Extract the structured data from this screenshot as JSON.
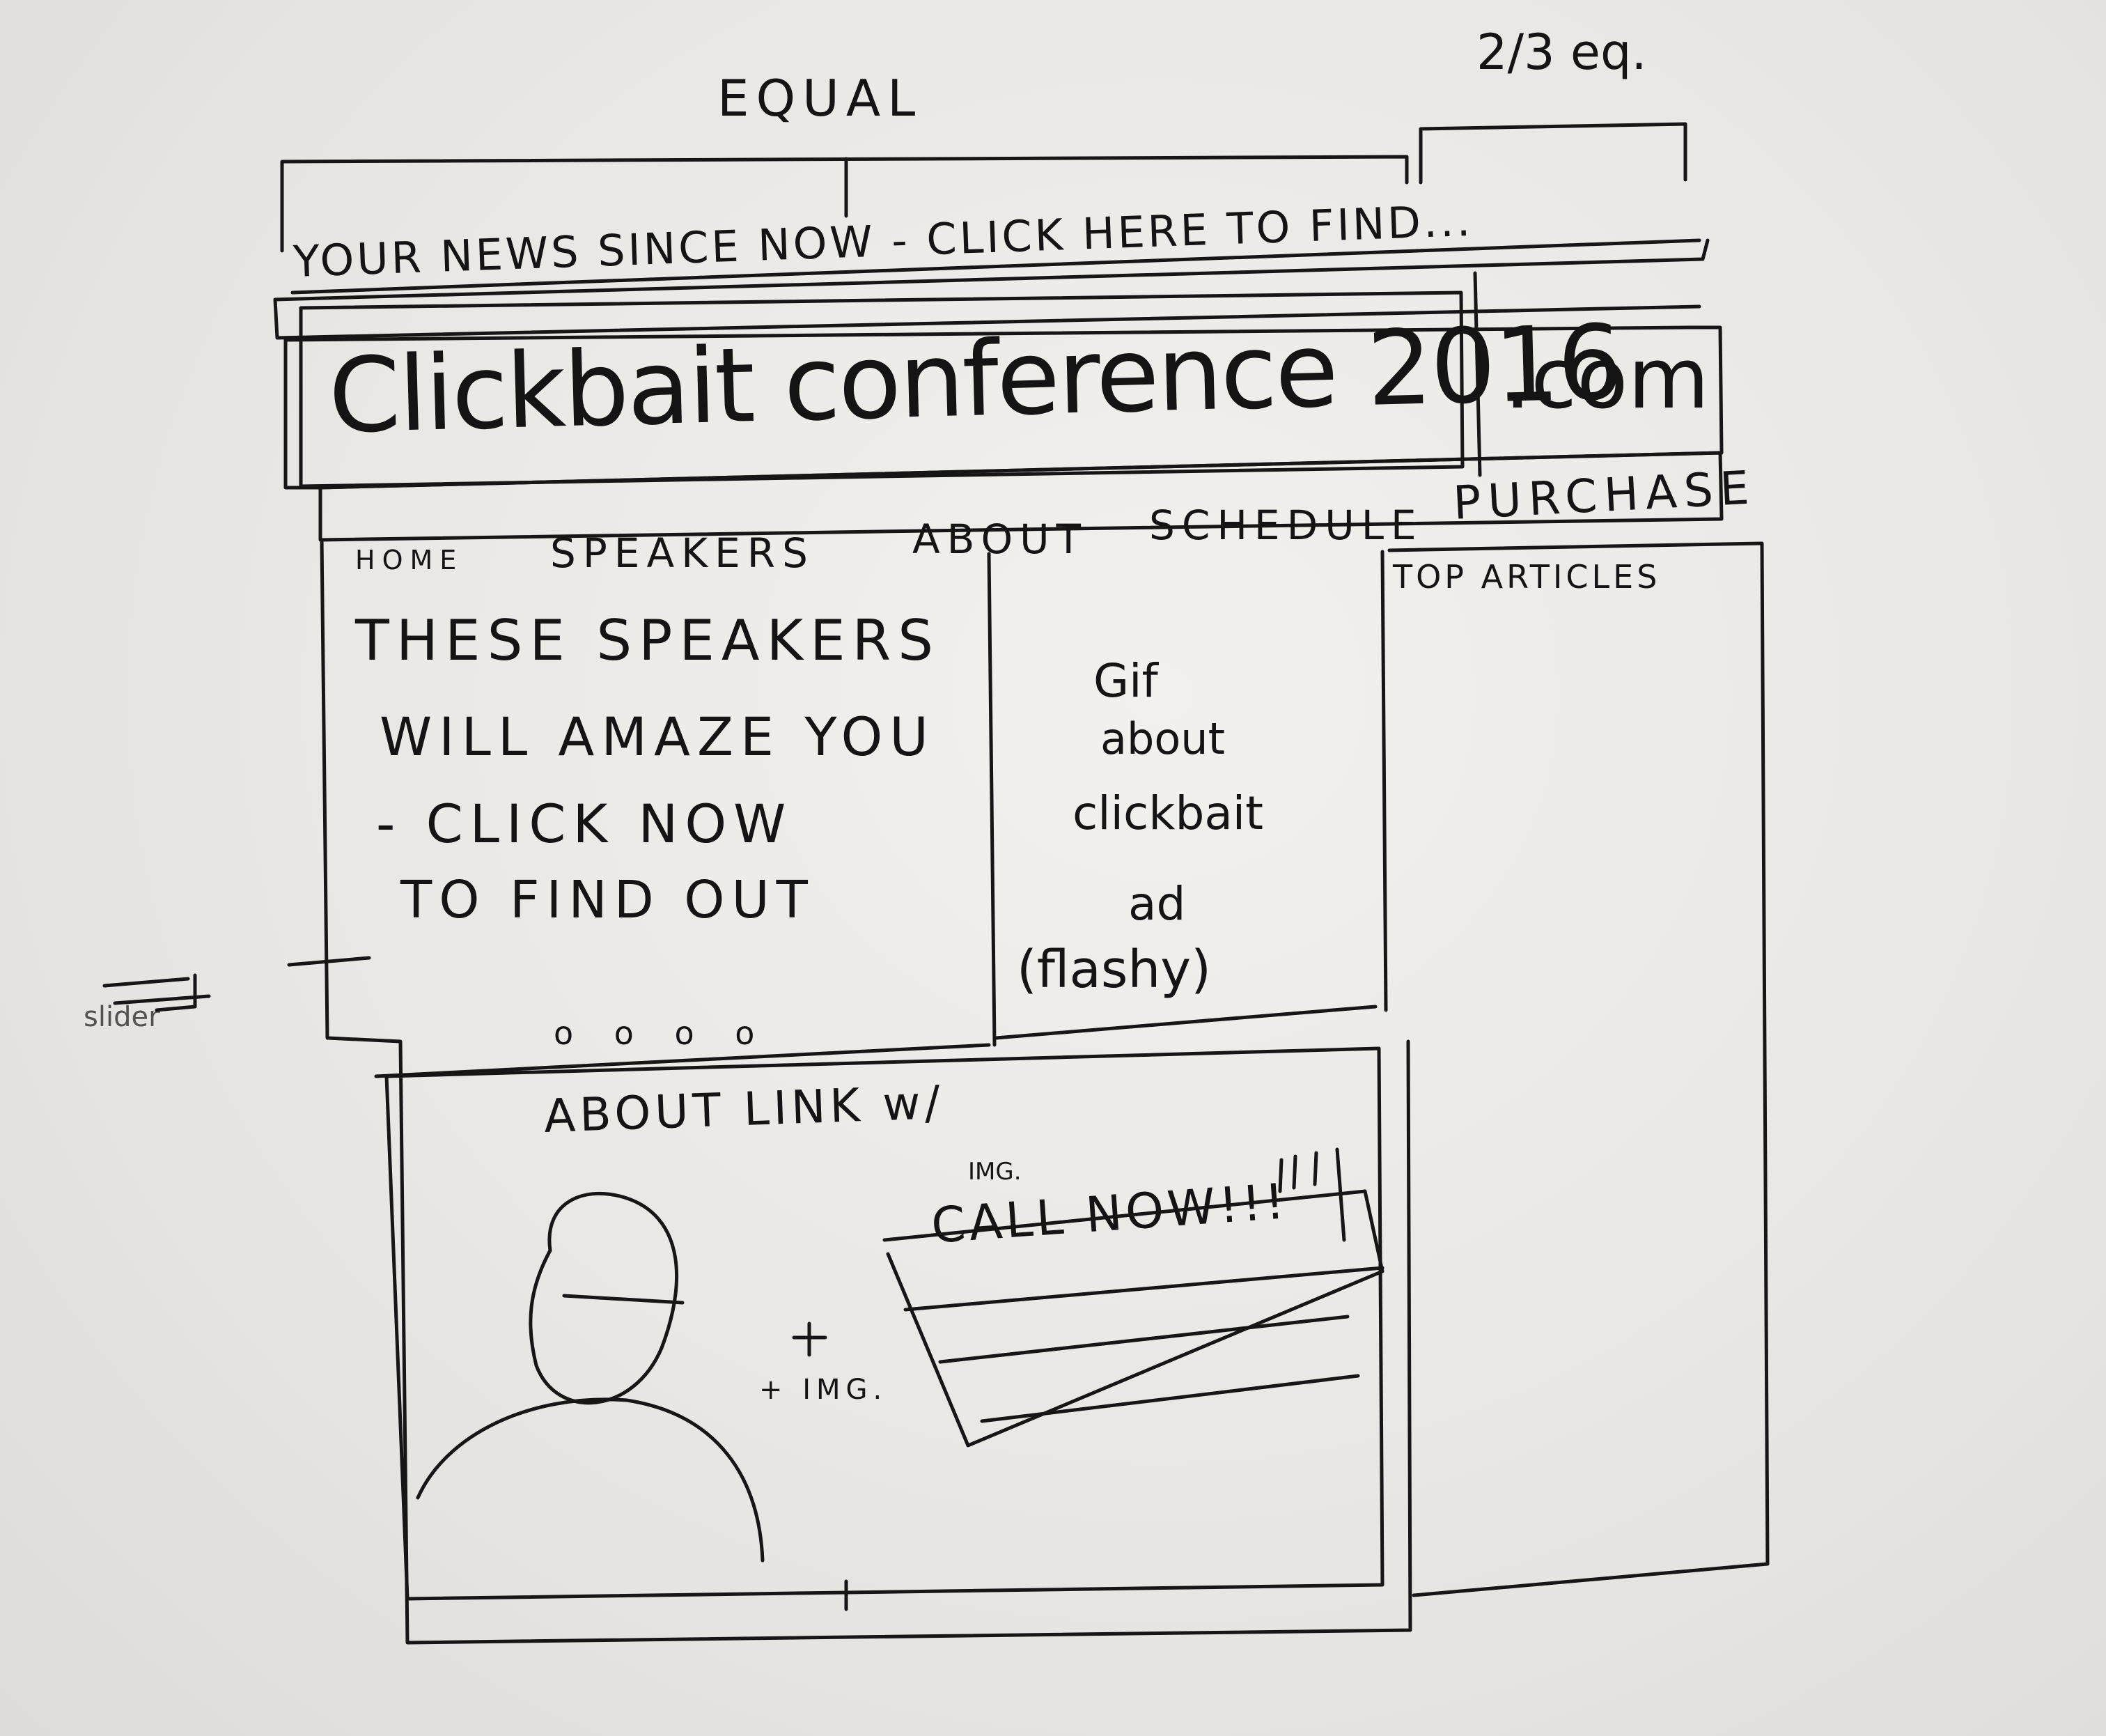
{
  "annotations": {
    "equal": "EQUAL",
    "two_thirds": "2/3 eq.",
    "slider_note": "slider"
  },
  "ticker": {
    "text": "YOUR NEWS SINCE NOW - CLICK HERE TO FIND..."
  },
  "header": {
    "logo": "Clickbait conference 2016",
    "domain": ".com"
  },
  "nav": {
    "items": [
      "HOME",
      "SPEAKERS",
      "ABOUT",
      "SCHEDULE",
      "PURCHASE"
    ]
  },
  "hero": {
    "lines": [
      "THESE SPEAKERS",
      "WILL AMAZE YOU",
      "- CLICK NOW",
      "TO FIND OUT"
    ],
    "dots": "o  o  o  o"
  },
  "ad": {
    "lines": [
      "Gif",
      "about",
      "clickbait",
      "ad",
      "(flashy)"
    ]
  },
  "sidebar": {
    "heading": "TOP ARTICLES"
  },
  "about": {
    "heading": "ABOUT LINK w/",
    "plus_label": "+ IMG.",
    "img_label": "IMG.",
    "call_label": "CALL NOW!!!"
  }
}
